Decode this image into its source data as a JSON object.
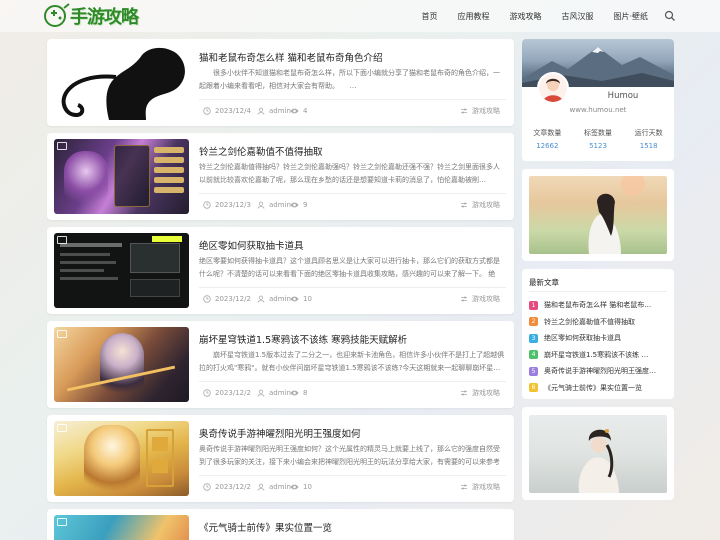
{
  "site": {
    "logo_text": "手游攻略",
    "colors": {
      "brand_green": "#2f8a2a",
      "accent_blue": "#4a8fd1"
    }
  },
  "nav": {
    "items": [
      "首页",
      "应用教程",
      "游戏攻略",
      "古风汉服",
      "图片·壁纸"
    ],
    "search_icon": "search-icon"
  },
  "posts": [
    {
      "title": "猫和老鼠布奇怎么样 猫和老鼠布奇角色介绍",
      "excerpt": "　　很多小伙伴不知道猫和老鼠布奇怎么样，所以下面小编就分享了猫和老鼠布奇的角色介绍，一起跟着小编来看看吧，相信对大家会有帮助。　　…",
      "date": "2023/12/4",
      "author": "admin",
      "views": "4",
      "category": "游戏攻略"
    },
    {
      "title": "铃兰之剑伦嘉勒值不值得抽取",
      "excerpt": "铃兰之剑伦嘉勒值得抽吗？铃兰之剑伦嘉勒强吗？铃兰之剑伦嘉勒还强不强？铃兰之剑里面很多人以前就比较喜欢伦嘉勒了呢，那么现在乡愁的话还是想要知道卡莉的消息了，怕伦嘉勒被削…",
      "date": "2023/12/3",
      "author": "admin",
      "views": "9",
      "category": "游戏攻略"
    },
    {
      "title": "绝区零如何获取抽卡道具",
      "excerpt": "绝区零要如何获得抽卡道具？这个道具顾名思义是让大家可以进行抽卡，那么它们的获取方式都是什么呢？不清楚的话可以来看看下面的绝区零抽卡道具收集攻略，感兴趣的可以来了解一下。 绝区…",
      "date": "2023/12/2",
      "author": "admin",
      "views": "10",
      "category": "游戏攻略"
    },
    {
      "title": "崩坏星穹铁道1.5寒鸦该不该练 寒鸦技能天赋解析",
      "excerpt": "　　崩坏星穹铁道1.5版本过去了二分之一，也迎来新卡池角色，相信许多小伙伴不是打上了超越俱拉的打火鸡\"寒鸦\"。就有小伙伴问崩坏星穹铁道1.5寒鸦该不该练?今天这期就来一起聊聊崩坏星…",
      "date": "2023/12/2",
      "author": "admin",
      "views": "8",
      "category": "游戏攻略"
    },
    {
      "title": "奥奇传说手游神曜烈阳光明王强度如何",
      "excerpt": "奥奇传说手游神曜烈阳光明王强度如何？这个光属性的精灵马上就要上线了，那么它的强度自然受到了很多玩家的关注，接下来小编会来把神曜烈阳光明王的玩法分享给大家，有需要的可以来参考参…",
      "date": "2023/12/2",
      "author": "admin",
      "views": "10",
      "category": "游戏攻略"
    },
    {
      "title": "《元气骑士前传》果实位置一览",
      "excerpt": "",
      "date": "",
      "author": "",
      "views": "",
      "category": ""
    }
  ],
  "profile": {
    "name": "Humou",
    "site": "www.humou.net",
    "stats": [
      {
        "label": "文章数量",
        "value": "12662"
      },
      {
        "label": "标签数量",
        "value": "5123"
      },
      {
        "label": "运行天数",
        "value": "1518"
      }
    ]
  },
  "latest": {
    "title": "最新文章",
    "items": [
      {
        "num": "1",
        "color": "#e44a7c",
        "text": "猫和老鼠布奇怎么样 猫和老鼠布…"
      },
      {
        "num": "2",
        "color": "#f08c3a",
        "text": "铃兰之剑伦嘉勒值不值得抽取"
      },
      {
        "num": "3",
        "color": "#3aaee0",
        "text": "绝区零如何获取抽卡道具"
      },
      {
        "num": "4",
        "color": "#4cc06b",
        "text": "崩坏星穹铁道1.5寒鸦该不该练 …"
      },
      {
        "num": "5",
        "color": "#9b7fe0",
        "text": "奥奇传说手游神曜烈阳光明王强度…"
      },
      {
        "num": "6",
        "color": "#f1c232",
        "text": "《元气骑士前传》果实位置一览"
      }
    ]
  }
}
